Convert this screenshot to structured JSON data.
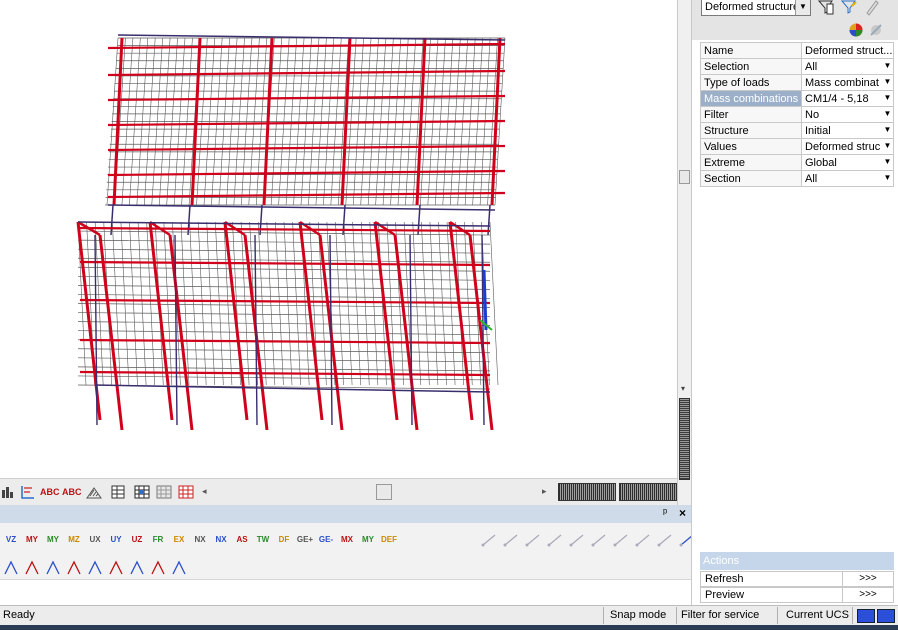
{
  "colors": {
    "frame_red": "#d0021b",
    "frame_dark": "#3a2d6e",
    "grid_gray": "#5a5a5a",
    "panel_blue": "#cfdbe8",
    "selected_row": "#9bb0c8"
  },
  "props": {
    "dropdown_value": "Deformed structure (",
    "rows": [
      {
        "key": "Name",
        "value": "Deformed struct...",
        "has_dropdown": false,
        "selected": false
      },
      {
        "key": "Selection",
        "value": "All",
        "has_dropdown": true,
        "selected": false
      },
      {
        "key": "Type of loads",
        "value": "Mass combinat",
        "has_dropdown": true,
        "selected": false
      },
      {
        "key": "Mass combinations",
        "value": "CM1/4 - 5,18",
        "has_dropdown": true,
        "selected": true
      },
      {
        "key": "Filter",
        "value": "No",
        "has_dropdown": true,
        "selected": false
      },
      {
        "key": "Structure",
        "value": "Initial",
        "has_dropdown": true,
        "selected": false
      },
      {
        "key": "Values",
        "value": "Deformed struc",
        "has_dropdown": true,
        "selected": false
      },
      {
        "key": "Extreme",
        "value": "Global",
        "has_dropdown": true,
        "selected": false
      },
      {
        "key": "Section",
        "value": "All",
        "has_dropdown": true,
        "selected": false
      }
    ],
    "actions_header": "Actions",
    "actions": [
      {
        "label": "Refresh",
        "go": ">>>"
      },
      {
        "label": "Preview",
        "go": ">>>"
      }
    ]
  },
  "status": {
    "ready": "Ready",
    "snap_mode": "Snap mode",
    "filter_for_service": "Filter for service",
    "current_ucs": "Current UCS"
  },
  "viewtoolbar": {
    "icons": [
      "chart-icon",
      "section-icon",
      "abc-label-icon",
      "abc-label-2-icon",
      "hatch-icon",
      "table-icon",
      "report-icon",
      "grid-view-icon",
      "grid-red-icon"
    ],
    "abc1": "ABC",
    "abc2": "ABC"
  },
  "resultpanel": {
    "row1_icons": [
      "VZ",
      "MY",
      "MY",
      "MZ",
      "UX",
      "UY",
      "UZ",
      "FR",
      "EX",
      "NX",
      "NX",
      "AS",
      "TW",
      "DF",
      "GE+",
      "GE-",
      "MX",
      "MY",
      "DEF"
    ],
    "row2_icons": [
      "R1",
      "R2",
      "R3",
      "R4",
      "R5",
      "R6",
      "R7",
      "R8",
      "R9"
    ],
    "pin": "ᵖ",
    "close": "×"
  }
}
